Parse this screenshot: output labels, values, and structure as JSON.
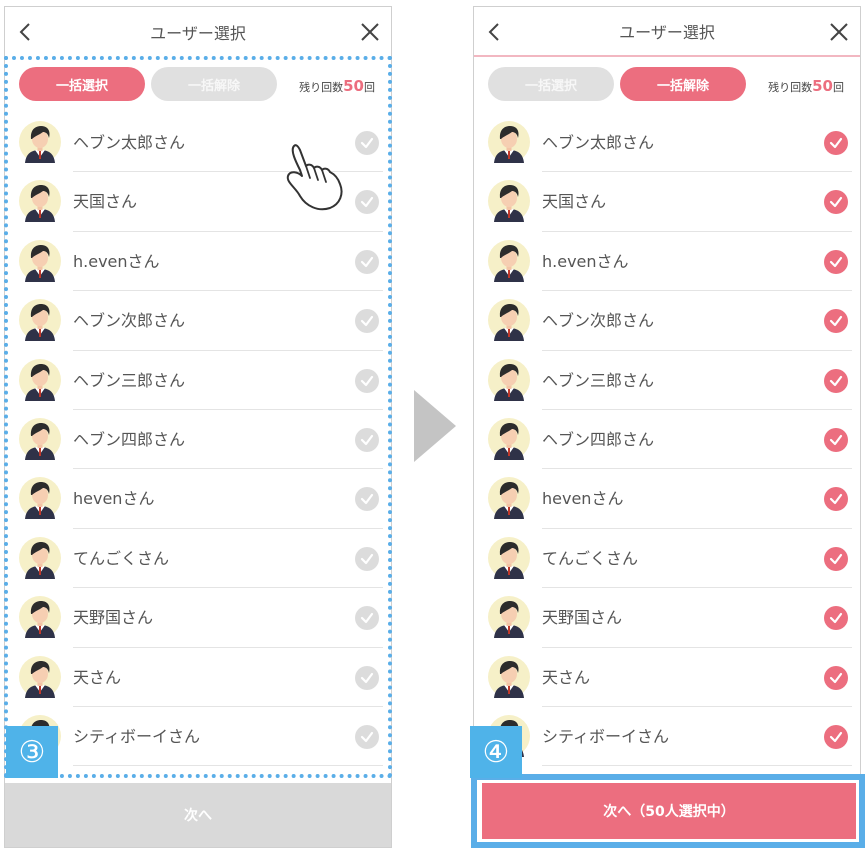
{
  "left": {
    "title": "ユーザー選択",
    "select_all_label": "一括選択",
    "deselect_all_label": "一括解除",
    "remaining_prefix": "残り回数",
    "remaining_count": "50",
    "remaining_suffix": "回",
    "users": [
      "ヘブン太郎さん",
      "天国さん",
      "h.evenさん",
      "ヘブン次郎さん",
      "ヘブン三郎さん",
      "ヘブン四郎さん",
      "hevenさん",
      "てんごくさん",
      "天野国さん",
      "天さん",
      "シティボーイさん"
    ],
    "checked": false,
    "footer_label": "次へ",
    "step": "③"
  },
  "right": {
    "title": "ユーザー選択",
    "select_all_label": "一括選択",
    "deselect_all_label": "一括解除",
    "remaining_prefix": "残り回数",
    "remaining_count": "50",
    "remaining_suffix": "回",
    "users": [
      "ヘブン太郎さん",
      "天国さん",
      "h.evenさん",
      "ヘブン次郎さん",
      "ヘブン三郎さん",
      "ヘブン四郎さん",
      "hevenさん",
      "てんごくさん",
      "天野国さん",
      "天さん",
      "シティボーイさん"
    ],
    "checked": true,
    "footer_label": "次へ（50人選択中）",
    "step": "④"
  },
  "colors": {
    "accent": "#ec6e7f",
    "highlight": "#5aaee8",
    "inactive": "#dcdcdc"
  },
  "icons": {
    "back": "chevron-left-icon",
    "close": "close-icon",
    "check": "check-icon",
    "transition": "triangle-arrow-icon",
    "pointer": "pointing-hand-icon"
  }
}
